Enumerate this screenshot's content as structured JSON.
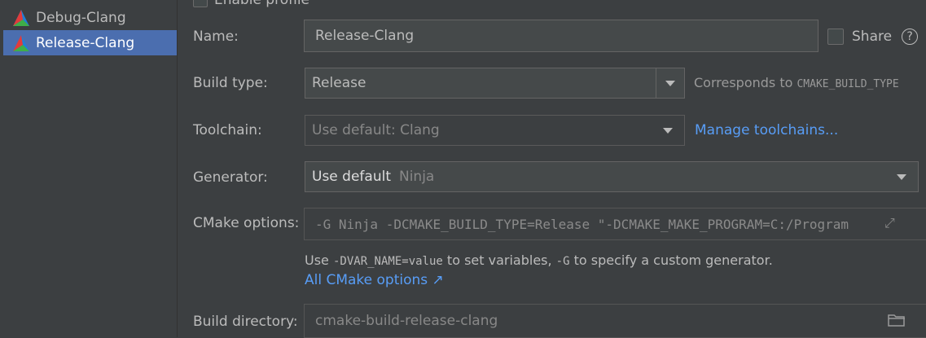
{
  "profiles": [
    {
      "label": "Debug-Clang",
      "icon": "cmake-triangle-icon"
    },
    {
      "label": "Release-Clang",
      "icon": "cmake-triangle-icon",
      "selected": true
    }
  ],
  "enable_profile_label": "Enable profile",
  "name": {
    "label": "Name:",
    "value": "Release-Clang"
  },
  "share": {
    "label": "Share",
    "help": "?"
  },
  "build_type": {
    "label": "Build type:",
    "value": "Release",
    "hint_prefix": "Corresponds to ",
    "hint_code": "CMAKE_BUILD_TYPE"
  },
  "toolchain": {
    "label": "Toolchain:",
    "value": "Use default: Clang",
    "link": "Manage toolchains..."
  },
  "generator": {
    "label": "Generator:",
    "value": "Use default",
    "value_secondary": "Ninja"
  },
  "cmake_options": {
    "label": "CMake options:",
    "value": "-G Ninja -DCMAKE_BUILD_TYPE=Release \"-DCMAKE_MAKE_PROGRAM=C:/Program",
    "hint_use": "Use ",
    "hint_code1": "-DVAR_NAME=value",
    "hint_mid": " to set variables, ",
    "hint_code2": "-G",
    "hint_end": " to specify a custom generator.",
    "link": "All CMake options ↗"
  },
  "build_directory": {
    "label": "Build directory:",
    "value": "cmake-build-release-clang"
  },
  "colors": {
    "accent": "#4b6eaf",
    "link": "#589df6",
    "background": "#3c3f41"
  }
}
